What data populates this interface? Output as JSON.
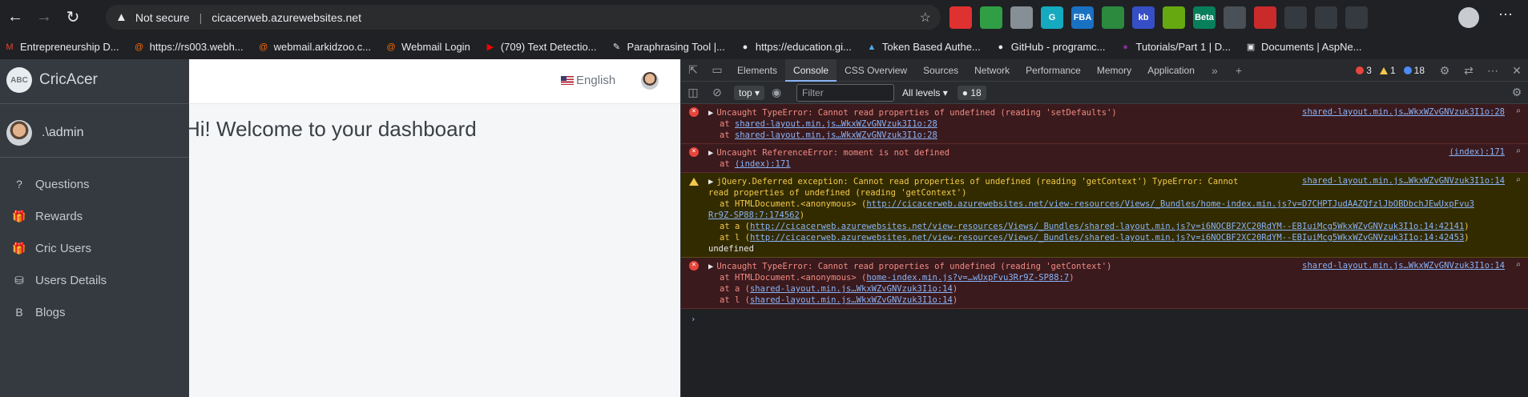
{
  "browser": {
    "security_label": "Not secure",
    "url": "cicacerweb.azurewebsites.net",
    "extensions": [
      {
        "name": "adblock-icon",
        "color": "#e03131",
        "text": ""
      },
      {
        "name": "extension-icon",
        "color": "#2f9e44",
        "text": ""
      },
      {
        "name": "extension-icon",
        "color": "#868e96",
        "text": ""
      },
      {
        "name": "grammarly-icon",
        "color": "#15aabf",
        "text": "G"
      },
      {
        "name": "extension-icon",
        "color": "#1971c2",
        "text": "FBA"
      },
      {
        "name": "extension-icon",
        "color": "#2b8a3e",
        "text": ""
      },
      {
        "name": "extension-icon",
        "color": "#364fc7",
        "text": "kb"
      },
      {
        "name": "download-icon",
        "color": "#66a80f",
        "text": ""
      },
      {
        "name": "extension-icon",
        "color": "#087f5b",
        "text": "Beta"
      },
      {
        "name": "extension-icon",
        "color": "#495057",
        "text": ""
      },
      {
        "name": "pdf-icon",
        "color": "#c92a2a",
        "text": ""
      },
      {
        "name": "puzzle-icon",
        "color": "#343a40",
        "text": ""
      },
      {
        "name": "favorites-icon",
        "color": "#343a40",
        "text": ""
      },
      {
        "name": "collections-icon",
        "color": "#343a40",
        "text": ""
      }
    ]
  },
  "bookmarks": [
    {
      "label": "Entrepreneurship D...",
      "color": "#ea4335",
      "glyph": "M"
    },
    {
      "label": "https://rs003.webh...",
      "color": "#f76707",
      "glyph": "@"
    },
    {
      "label": "webmail.arkidzoo.c...",
      "color": "#f76707",
      "glyph": "@"
    },
    {
      "label": "Webmail Login",
      "color": "#f76707",
      "glyph": "@"
    },
    {
      "label": "(709) Text Detectio...",
      "color": "#ff0000",
      "glyph": "▶"
    },
    {
      "label": "Paraphrasing Tool |...",
      "color": "#e8eaed",
      "glyph": "✎"
    },
    {
      "label": "https://education.gi...",
      "color": "#e8eaed",
      "glyph": "●"
    },
    {
      "label": "Token Based Authe...",
      "color": "#4dabf7",
      "glyph": "▲"
    },
    {
      "label": "GitHub - programc...",
      "color": "#e8eaed",
      "glyph": "●"
    },
    {
      "label": "Tutorials/Part 1 | D...",
      "color": "#862e9c",
      "glyph": "●"
    },
    {
      "label": "Documents | AspNe...",
      "color": "#e8eaed",
      "glyph": "▣"
    }
  ],
  "app": {
    "brand": "CricAcer",
    "brand_logo_text": "ABC",
    "user": ".\\admin",
    "language": "English",
    "welcome": "Hi! Welcome to your dashboard",
    "menu": [
      {
        "label": "Questions",
        "icon": "?",
        "icon_name": "question-circle-icon"
      },
      {
        "label": "Rewards",
        "icon": "🎁",
        "icon_name": "gift-icon"
      },
      {
        "label": "Cric Users",
        "icon": "🎁",
        "icon_name": "gift-icon"
      },
      {
        "label": "Users Details",
        "icon": "⛁",
        "icon_name": "sitemap-icon"
      },
      {
        "label": "Blogs",
        "icon": "B",
        "icon_name": "bold-icon"
      }
    ]
  },
  "devtools": {
    "tabs": [
      "Elements",
      "Console",
      "CSS Overview",
      "Sources",
      "Network",
      "Performance",
      "Memory",
      "Application"
    ],
    "active_tab": "Console",
    "error_count": "3",
    "warning_count": "1",
    "message_count": "18",
    "context": "top",
    "filter_placeholder": "Filter",
    "levels": "All levels",
    "messages_badge": "18",
    "entries": [
      {
        "level": "error",
        "source": "shared-layout.min.js…WkxWZvGNVzuk3I1o:28",
        "lines": [
          {
            "type": "head",
            "text": "Uncaught TypeError: Cannot read properties of undefined (reading 'setDefaults')"
          },
          {
            "type": "at",
            "prefix": "at ",
            "link": "shared-layout.min.js…WkxWZvGNVzuk3I1o:28",
            "suffix": ""
          },
          {
            "type": "at",
            "prefix": "at ",
            "link": "shared-layout.min.js…WkxWZvGNVzuk3I1o:28",
            "suffix": ""
          }
        ]
      },
      {
        "level": "error",
        "source": "(index):171",
        "lines": [
          {
            "type": "head",
            "text": "Uncaught ReferenceError: moment is not defined"
          },
          {
            "type": "at",
            "prefix": "at ",
            "link": "(index):171",
            "suffix": ""
          }
        ]
      },
      {
        "level": "warning",
        "source": "shared-layout.min.js…WkxWZvGNVzuk3I1o:14",
        "lines": [
          {
            "type": "head",
            "text": "jQuery.Deferred exception: Cannot read properties of undefined (reading 'getContext') TypeError: Cannot"
          },
          {
            "type": "plainline",
            "text": "read properties of undefined (reading 'getContext')"
          },
          {
            "type": "at",
            "prefix": "at HTMLDocument.<anonymous> (",
            "link": "http://cicacerweb.azurewebsites.net/view-resources/Views/_Bundles/home-index.min.js?v=D7CHPTJudAAZQfzlJbOBDbchJEwUxpFvu3",
            "suffix": ""
          },
          {
            "type": "contlink",
            "link": "Rr9Z-SP88:7:174562",
            "suffix": ")"
          },
          {
            "type": "at",
            "prefix": "at a (",
            "link": "http://cicacerweb.azurewebsites.net/view-resources/Views/_Bundles/shared-layout.min.js?v=i6NOCBF2XC20RdYM--EBIuiMcg5WkxWZvGNVzuk3I1o:14:42141",
            "suffix": ")"
          },
          {
            "type": "at",
            "prefix": "at l (",
            "link": "http://cicacerweb.azurewebsites.net/view-resources/Views/_Bundles/shared-layout.min.js?v=i6NOCBF2XC20RdYM--EBIuiMcg5WkxWZvGNVzuk3I1o:14:42453",
            "suffix": ")"
          },
          {
            "type": "plain",
            "text": "undefined"
          }
        ]
      },
      {
        "level": "error",
        "source": "shared-layout.min.js…WkxWZvGNVzuk3I1o:14",
        "lines": [
          {
            "type": "head",
            "text": "Uncaught TypeError: Cannot read properties of undefined (reading 'getContext')"
          },
          {
            "type": "at",
            "prefix": "at HTMLDocument.<anonymous> (",
            "link": "home-index.min.js?v=…wUxpFvu3Rr9Z-SP88:7",
            "suffix": ")"
          },
          {
            "type": "at",
            "prefix": "at a (",
            "link": "shared-layout.min.js…WkxWZvGNVzuk3I1o:14",
            "suffix": ")"
          },
          {
            "type": "at",
            "prefix": "at l (",
            "link": "shared-layout.min.js…WkxWZvGNVzuk3I1o:14",
            "suffix": ")"
          }
        ]
      }
    ]
  }
}
